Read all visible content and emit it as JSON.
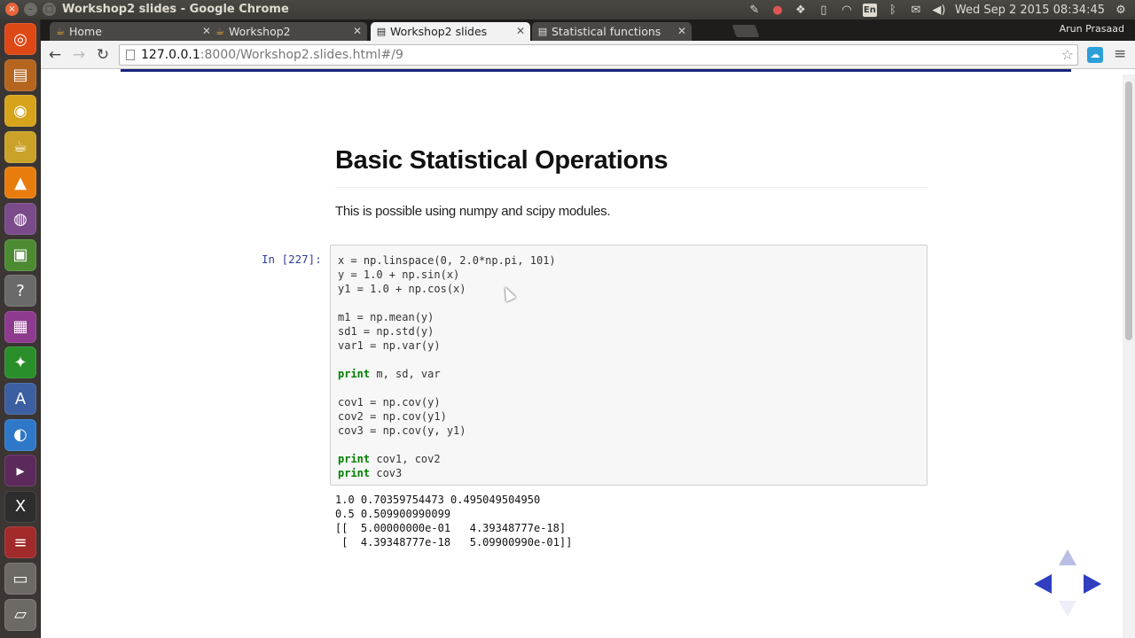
{
  "panel": {
    "window_title": "Workshop2 slides - Google Chrome",
    "keyboard_layout": "En",
    "clock": "Wed Sep  2 2015 08:34:45",
    "window_controls": [
      "×",
      "–",
      "□"
    ]
  },
  "launcher": {
    "items": [
      {
        "name": "dash",
        "glyph": "◎",
        "color": "#dd4814"
      },
      {
        "name": "files",
        "glyph": "▤",
        "color": "#b5651d"
      },
      {
        "name": "chrome",
        "glyph": "◉",
        "color": "#d6a31b"
      },
      {
        "name": "ipython-notebook",
        "glyph": "☕",
        "color": "#c9a227"
      },
      {
        "name": "vlc",
        "glyph": "▲",
        "color": "#e87d0d"
      },
      {
        "name": "screen-recorder",
        "glyph": "◍",
        "color": "#7a4a8a"
      },
      {
        "name": "cube-game",
        "glyph": "▣",
        "color": "#4c8b32"
      },
      {
        "name": "help",
        "glyph": "?",
        "color": "#6a6a6a"
      },
      {
        "name": "calendar",
        "glyph": "▦",
        "color": "#8e3a8e"
      },
      {
        "name": "software-center",
        "glyph": "✦",
        "color": "#2a8f2a"
      },
      {
        "name": "font-viewer",
        "glyph": "A",
        "color": "#3b5fa0"
      },
      {
        "name": "browser-globe",
        "glyph": "◐",
        "color": "#2f78c9"
      },
      {
        "name": "terminal",
        "glyph": "▸",
        "color": "#5b2a5b"
      },
      {
        "name": "xournal",
        "glyph": "X",
        "color": "#2d2d2d"
      },
      {
        "name": "app-red",
        "glyph": "≡",
        "color": "#a12a2a"
      },
      {
        "name": "drive",
        "glyph": "▭",
        "color": "#6d6a66"
      },
      {
        "name": "trash",
        "glyph": "▱",
        "color": "#6d6a66"
      }
    ]
  },
  "tabs": [
    {
      "label": "Home",
      "icon": "notebook-icon",
      "active": false
    },
    {
      "label": "Workshop2",
      "icon": "notebook-icon",
      "active": false
    },
    {
      "label": "Workshop2 slides",
      "icon": "page-icon",
      "active": true
    },
    {
      "label": "Statistical functions",
      "icon": "page-icon",
      "active": false
    }
  ],
  "profile_name": "Arun Prasaad",
  "toolbar": {
    "url_host": "127.0.0.1",
    "url_path": ":8000/Workshop2.slides.html#/9"
  },
  "slide": {
    "title": "Basic Statistical Operations",
    "text": "This is possible using numpy and scipy modules.",
    "prompt": "In [227]:",
    "code_lines": [
      "x = np.linspace(0, 2.0*np.pi, 101)",
      "y = 1.0 + np.sin(x)",
      "y1 = 1.0 + np.cos(x)",
      "",
      "m1 = np.mean(y)",
      "sd1 = np.std(y)",
      "var1 = np.var(y)",
      "",
      "print m, sd, var",
      "",
      "cov1 = np.cov(y)",
      "cov2 = np.cov(y1)",
      "cov3 = np.cov(y, y1)",
      "",
      "print cov1, cov2",
      "print cov3"
    ],
    "output_lines": [
      "1.0 0.70359754473 0.495049504950",
      "0.5 0.509900990099",
      "[[  5.00000000e-01   4.39348777e-18]",
      " [  4.39348777e-18   5.09900990e-01]]"
    ]
  },
  "colors": {
    "keyword": "#008000",
    "prompt": "#2f3f9f",
    "nav_arrow": "#2f3fbf"
  }
}
